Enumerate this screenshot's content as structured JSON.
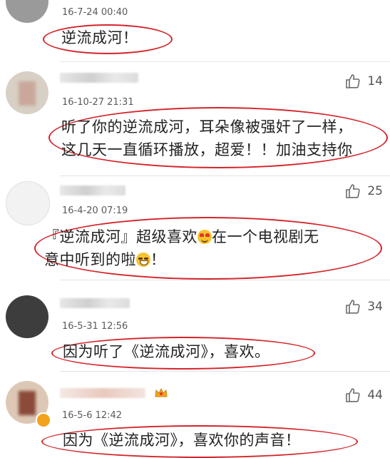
{
  "comments": [
    {
      "time": "16-7-24 00:40",
      "lines": [
        "逆流成河！"
      ],
      "likes": ""
    },
    {
      "time": "16-10-27 21:31",
      "lines": [
        "听了你的逆流成河，耳朵像被强奸了一样，",
        "这几天一直循环播放，超爱！！加油支持你"
      ],
      "likes": "14"
    },
    {
      "time": "16-4-20 07:19",
      "line1_a": "『逆流成河』超级喜欢",
      "line1_b": "在一个电视剧无",
      "line2_a": "意中听到的啦",
      "line2_b": "！",
      "likes": "25"
    },
    {
      "time": "16-5-31 12:56",
      "lines": [
        "因为听了《逆流成河》，喜欢。"
      ],
      "likes": "34"
    },
    {
      "time": "16-5-6 12:42",
      "lines": [
        "因为《逆流成河》，喜欢你的声音！"
      ],
      "likes": "44"
    }
  ],
  "icons": {
    "like": "thumbs-up-icon",
    "verified": "verified-badge-icon",
    "crown": "crown-icon",
    "heart_eyes": "heart-eyes-emoji",
    "grin": "grin-emoji"
  },
  "colors": {
    "annotation": "#d4242a"
  }
}
